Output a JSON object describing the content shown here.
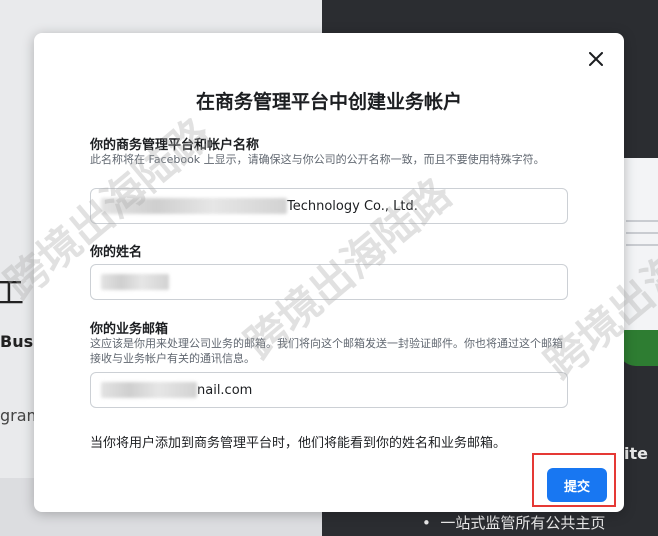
{
  "background": {
    "left_glyph": "工",
    "left_fragment_1": "Bus",
    "left_fragment_2": "gram",
    "right_fragment": "ite",
    "right_bullet": "一站式监管所有公共主页"
  },
  "watermark": "跨境出海陆路",
  "modal": {
    "title": "在商务管理平台中创建业务帐户",
    "business_name": {
      "label": "你的商务管理平台和帐户名称",
      "help": "此名称将在 Facebook 上显示，请确保这与你公司的公开名称一致，而且不要使用特殊字符。",
      "value_visible": "Technology Co., Ltd."
    },
    "your_name": {
      "label": "你的姓名"
    },
    "business_email": {
      "label": "你的业务邮箱",
      "help": "这应该是你用来处理公司业务的邮箱。我们将向这个邮箱发送一封验证邮件。你也将通过这个邮箱接收与业务帐户有关的通讯信息。",
      "value_visible": "nail.com"
    },
    "footer_note": "当你将用户添加到商务管理平台时，他们将能看到你的姓名和业务邮箱。",
    "submit_label": "提交"
  },
  "colors": {
    "primary": "#1877f2",
    "highlight_border": "#e53935",
    "overlay_dark": "#2b2d31"
  }
}
